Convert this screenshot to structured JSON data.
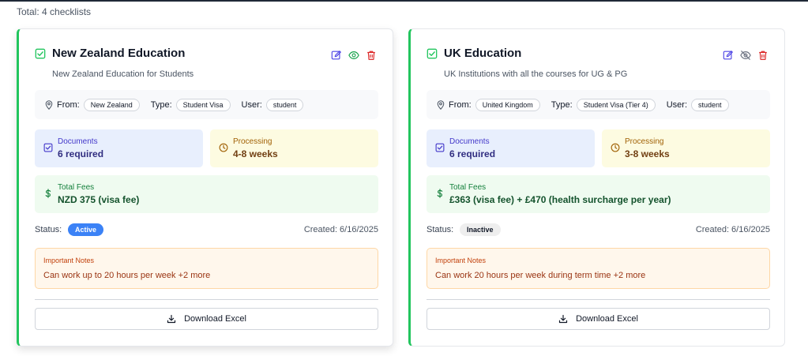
{
  "summary": {
    "total_text": "Total: 4 checklists"
  },
  "colors": {
    "accent_green": "#22c55e",
    "active_blue": "#3b82f6",
    "edit_blue": "#4f46e5",
    "delete_red": "#dc2626"
  },
  "labels": {
    "from": "From:",
    "type": "Type:",
    "user": "User:",
    "documents": "Documents",
    "processing": "Processing",
    "total_fees": "Total Fees",
    "status": "Status:",
    "important_notes": "Important Notes",
    "download": "Download Excel"
  },
  "cards": [
    {
      "title": "New Zealand Education",
      "description": "New Zealand Education for Students",
      "from": "New Zealand",
      "type": "Student Visa",
      "user": "student",
      "documents": "6 required",
      "processing": "4-8 weeks",
      "fees": "NZD 375 (visa fee)",
      "status": "Active",
      "created": "Created: 6/16/2025",
      "notes": "Can work up to 20 hours per week +2 more",
      "visibility_icon": "eye-icon"
    },
    {
      "title": "UK Education",
      "description": "UK Institutions with all the courses for UG & PG",
      "from": "United Kingdom",
      "type": "Student Visa (Tier 4)",
      "user": "student",
      "documents": "6 required",
      "processing": "3-8 weeks",
      "fees": "£363 (visa fee) + £470 (health surcharge per year)",
      "status": "Inactive",
      "created": "Created: 6/16/2025",
      "notes": "Can work 20 hours per week during term time +2 more",
      "visibility_icon": "eye-off-icon"
    }
  ]
}
